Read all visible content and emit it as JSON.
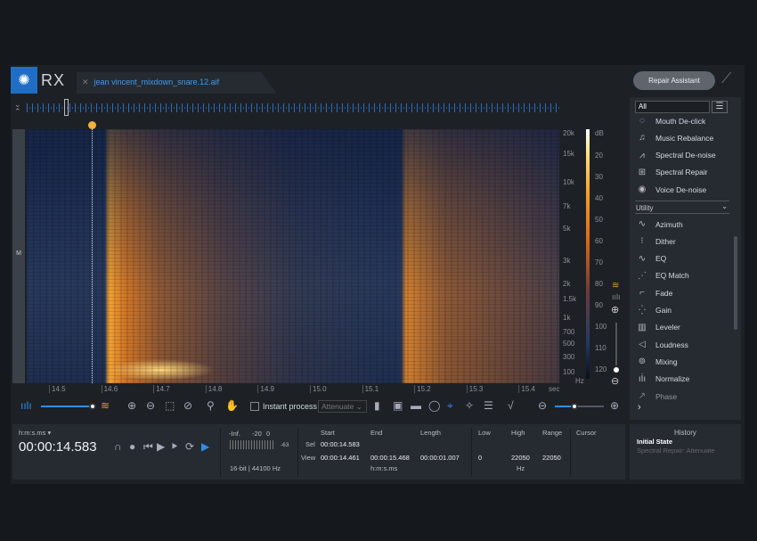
{
  "app": {
    "name": "RX",
    "file_tab": "jean vincent_mixdown_snare.12.aif",
    "repair_assistant": "Repair Assistant"
  },
  "spectrogram": {
    "channel": "M",
    "freq_labels": [
      "20k",
      "15k",
      "10k",
      "7k",
      "5k",
      "3k",
      "2k",
      "1.5k",
      "1k",
      "700",
      "500",
      "300",
      "100",
      "Hz"
    ],
    "db_labels": [
      "dB",
      "20",
      "30",
      "40",
      "50",
      "60",
      "70",
      "80",
      "90",
      "100",
      "110",
      "120"
    ],
    "time_labels": [
      "14.5",
      "14.6",
      "14.7",
      "14.8",
      "14.9",
      "15.0",
      "15.1",
      "15.2",
      "15.3",
      "15.4"
    ],
    "time_unit": "sec"
  },
  "toolbar": {
    "instant_process": "Instant process",
    "instant_process_checked": false,
    "mode": "Attenuate",
    "accent": "#2f8de8"
  },
  "modules": {
    "filter": "All",
    "items_top": [
      {
        "label": "Mouth De-click",
        "icon": "mouth-icon"
      },
      {
        "label": "Music Rebalance",
        "icon": "music-icon"
      },
      {
        "label": "Spectral De-noise",
        "icon": "spectral-denoise-icon"
      },
      {
        "label": "Spectral Repair",
        "icon": "spectral-repair-icon"
      },
      {
        "label": "Voice De-noise",
        "icon": "voice-icon"
      }
    ],
    "group": "Utility",
    "items_utility": [
      {
        "label": "Azimuth",
        "icon": "azimuth-icon"
      },
      {
        "label": "Dither",
        "icon": "dither-icon"
      },
      {
        "label": "EQ",
        "icon": "eq-icon"
      },
      {
        "label": "EQ Match",
        "icon": "eq-match-icon"
      },
      {
        "label": "Fade",
        "icon": "fade-icon"
      },
      {
        "label": "Gain",
        "icon": "gain-icon"
      },
      {
        "label": "Leveler",
        "icon": "leveler-icon"
      },
      {
        "label": "Loudness",
        "icon": "loudness-icon"
      },
      {
        "label": "Mixing",
        "icon": "mixing-icon"
      },
      {
        "label": "Normalize",
        "icon": "normalize-icon"
      },
      {
        "label": "Phase",
        "icon": "phase-icon"
      }
    ]
  },
  "transport": {
    "format": "h:m:s.ms",
    "time": "00:00:14.583"
  },
  "meter": {
    "labels": [
      "-Inf.",
      "-20",
      "0"
    ],
    "peak": "-63",
    "info": "16-bit | 44100 Hz"
  },
  "selection": {
    "headers": [
      "Start",
      "End",
      "Length"
    ],
    "sel_label": "Sel",
    "view_label": "View",
    "sel_start": "00:00:14.583",
    "view_start": "00:00:14.461",
    "view_end": "00:00:15.468",
    "view_length": "00:00:01.007",
    "unit": "h:m:s.ms"
  },
  "freq": {
    "headers": [
      "Low",
      "High",
      "Range"
    ],
    "low": "0",
    "high": "22050",
    "range": "22050",
    "unit": "Hz"
  },
  "cursor": {
    "label": "Cursor"
  },
  "history": {
    "title": "History",
    "items": [
      "Initial State",
      "Spectral Repair: Attenuate"
    ]
  }
}
